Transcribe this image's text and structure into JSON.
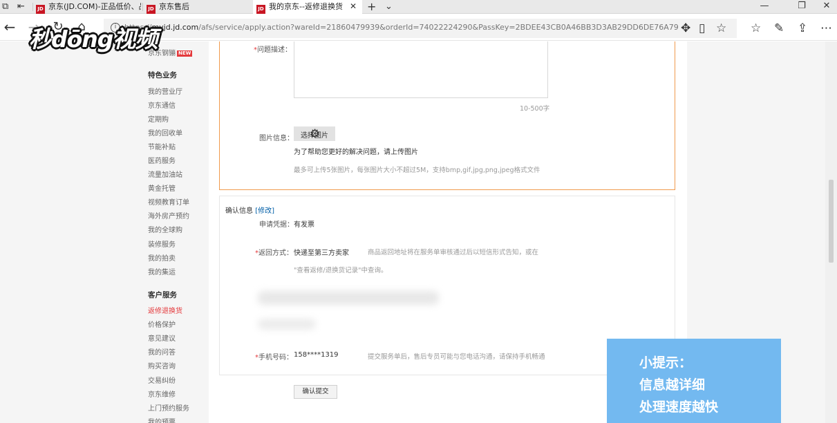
{
  "tabs": [
    {
      "label": "京东(JD.COM)-正品低价、品",
      "badge": "JD"
    },
    {
      "label": "京东售后",
      "badge": "JD"
    },
    {
      "label": "我的京东--返修退换货",
      "badge": "JD"
    }
  ],
  "address_bar": {
    "url_prefix": "https://",
    "url_host": "myjd.jd.com",
    "url_path": "/afs/service/apply.action?wareId=21860479939&orderId=74022224290&PassKey=2BDEE43CB0A46BB3D3AB29DD6DE76A79"
  },
  "watermark": {
    "text": "秒dōng视频"
  },
  "sidebar": {
    "top_item": {
      "label": "京东钢镚",
      "badge": "NEW"
    },
    "section1_title": "特色业务",
    "section1_items": [
      "我的营业厅",
      "京东通信",
      "定期购",
      "我的回收单",
      "节能补贴",
      "医药服务",
      "流量加油站",
      "黄金托管",
      "视频教育订单",
      "海外房产预约",
      "我的全球购",
      "装修服务",
      "我的拍卖",
      "我的集运"
    ],
    "section2_title": "客户服务",
    "section2_items": [
      "返修退换货",
      "价格保护",
      "意见建议",
      "我的问答",
      "购买咨询",
      "交易纠纷",
      "京东维修",
      "上门预约服务",
      "我的预票"
    ]
  },
  "form": {
    "problem_label": "问题描述：",
    "required_mark": "*",
    "char_limit": "10-500字",
    "image_label": "图片信息：",
    "upload_button": "选择图片",
    "upload_help": "为了帮助您更好的解决问题，请上传图片",
    "upload_rules": "最多可上传5张图片，每张图片大小不超过5M，支持bmp,gif,jpg,png,jpeg格式文件"
  },
  "confirm": {
    "title": "确认信息",
    "edit_link": "[修改]",
    "voucher_label": "申请凭据：",
    "voucher_value": "有发票",
    "return_label": "返回方式：",
    "return_value": "快递至第三方卖家",
    "return_hint1": "商品返回地址将在服务单审核通过后以短信形式告知，或在",
    "return_hint2": "\"查看返修/退换货记录\"中查询。",
    "phone_label": "手机号码：",
    "phone_value": "158****1319",
    "phone_hint": "提交服务单后，售后专员可能与您电话沟通，请保持手机畅通"
  },
  "submit_button": "确认提交",
  "tip": {
    "line1": "小提示：",
    "line2": "信息越详细",
    "line3": "处理速度越快"
  }
}
